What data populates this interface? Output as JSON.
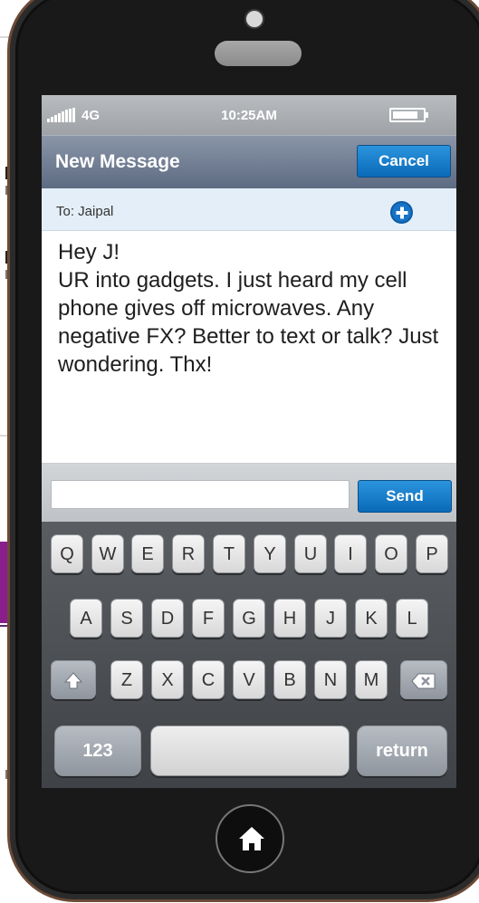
{
  "status_bar": {
    "network": "4G",
    "time": "10:25AM",
    "battery_level": 0.85
  },
  "nav": {
    "title": "New Message",
    "cancel_label": "Cancel"
  },
  "recipient": {
    "label": "To: Jaipal"
  },
  "message": {
    "text": "Hey J!\nUR into gadgets. I just heard my cell phone gives off microwaves. Any negative FX? Better to text or talk?  Just wondering. Thx!"
  },
  "compose": {
    "input_value": "",
    "send_label": "Send"
  },
  "keyboard": {
    "row1": [
      "Q",
      "W",
      "E",
      "R",
      "T",
      "Y",
      "U",
      "I",
      "O",
      "P"
    ],
    "row2": [
      "A",
      "S",
      "D",
      "F",
      "G",
      "H",
      "J",
      "K",
      "L"
    ],
    "row3": [
      "Z",
      "X",
      "C",
      "V",
      "B",
      "N",
      "M"
    ],
    "numbers_label": "123",
    "return_label": "return",
    "shift_icon": "shift-arrow-icon",
    "backspace_icon": "backspace-icon"
  },
  "icons": {
    "add_contact": "plus-circle-icon",
    "home": "home-icon"
  },
  "colors": {
    "accent_blue": "#0a6ab8",
    "phone_frame": "#6b4a37",
    "nav_bar": "#5d6b82"
  }
}
